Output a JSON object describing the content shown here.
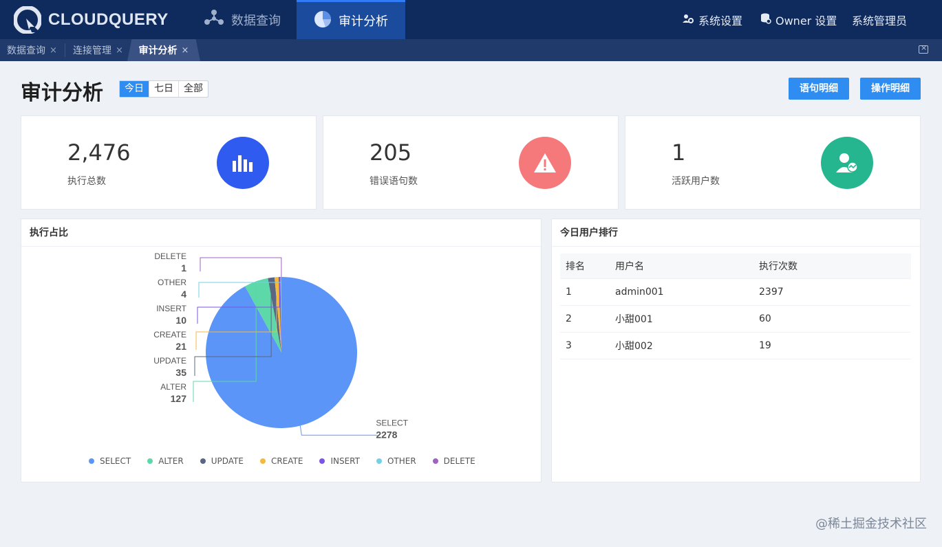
{
  "app": {
    "logo_text": "CLOUDQUERY"
  },
  "nav": {
    "items": [
      {
        "label": "数据查询",
        "icon": "share-nodes-icon"
      },
      {
        "label": "审计分析",
        "icon": "pie-chart-icon",
        "active": true
      }
    ],
    "right": [
      {
        "label": "系统设置",
        "icon": "users-gear-icon"
      },
      {
        "label": "Owner 设置",
        "icon": "database-gear-icon"
      },
      {
        "label": "系统管理员",
        "icon": ""
      }
    ]
  },
  "tabs": [
    {
      "label": "数据查询",
      "close": "×"
    },
    {
      "label": "连接管理",
      "close": "×"
    },
    {
      "label": "审计分析",
      "close": "×",
      "active": true
    }
  ],
  "page": {
    "title": "审计分析",
    "range_options": [
      "今日",
      "七日",
      "全部"
    ],
    "range_selected": "今日",
    "buttons": [
      "语句明细",
      "操作明细"
    ]
  },
  "stats": [
    {
      "value": "2,476",
      "label": "执行总数",
      "color": "#2f5bf0",
      "icon": "bar-chart-icon"
    },
    {
      "value": "205",
      "label": "错误语句数",
      "color": "#f5787b",
      "icon": "warning-icon"
    },
    {
      "value": "1",
      "label": "活跃用户数",
      "color": "#25b58f",
      "icon": "user-activity-icon"
    }
  ],
  "pie_panel": {
    "title": "执行占比"
  },
  "chart_data": {
    "type": "pie",
    "categories": [
      "SELECT",
      "ALTER",
      "UPDATE",
      "CREATE",
      "INSERT",
      "OTHER",
      "DELETE"
    ],
    "values": [
      2278,
      127,
      35,
      21,
      10,
      4,
      1
    ],
    "colors": [
      "#5b95f7",
      "#5dd8a8",
      "#5a6782",
      "#f5b93c",
      "#7a55e6",
      "#74cfe8",
      "#9c63c3"
    ],
    "legend": "bottom"
  },
  "ranking": {
    "title": "今日用户排行",
    "columns": [
      "排名",
      "用户名",
      "执行次数"
    ],
    "rows": [
      [
        "1",
        "admin001",
        "2397"
      ],
      [
        "2",
        "小甜001",
        "60"
      ],
      [
        "3",
        "小甜002",
        "19"
      ]
    ]
  },
  "watermark": "@稀土掘金技术社区"
}
